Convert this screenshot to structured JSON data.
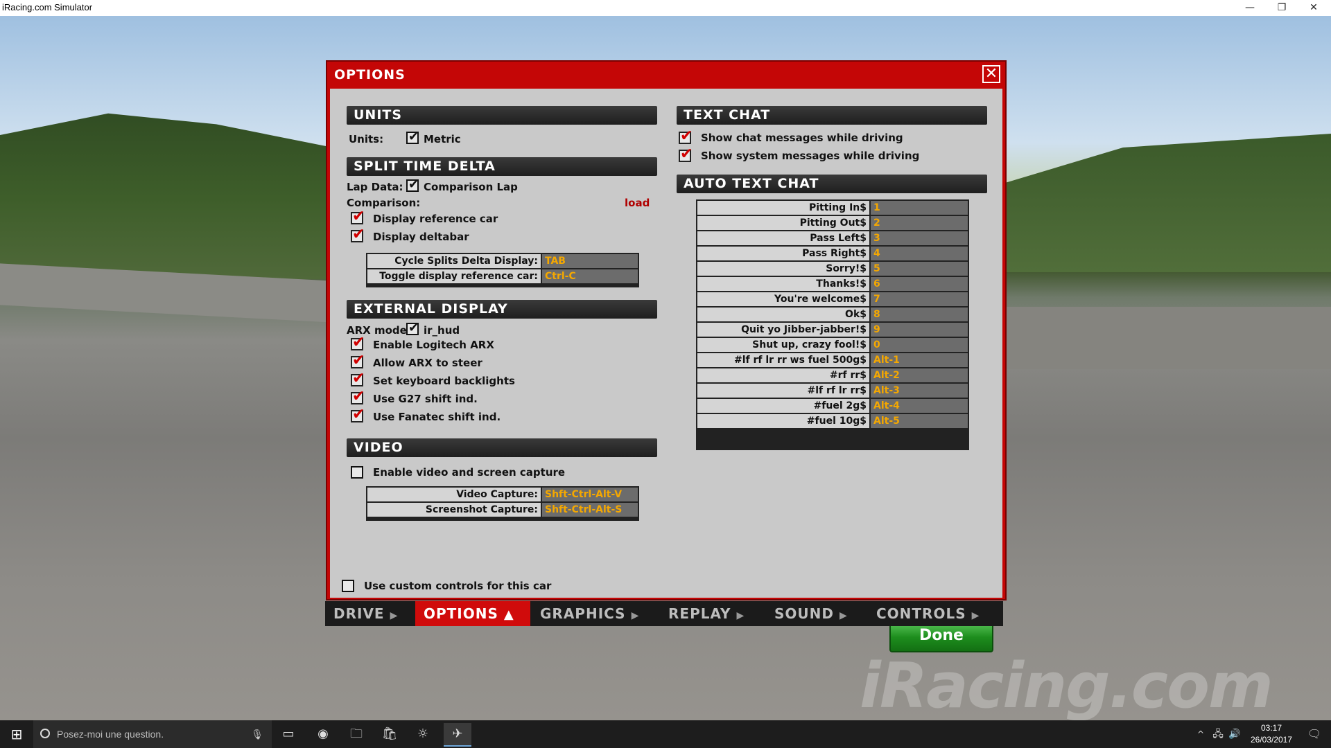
{
  "window": {
    "title": "iRacing.com Simulator",
    "minimize": "—",
    "restore": "❐",
    "close": "✕"
  },
  "watermark": "iRacing.com",
  "dialog": {
    "title": "OPTIONS",
    "close_glyph": "✕",
    "units": {
      "header": "UNITS",
      "label": "Units:",
      "metric_label": "Metric",
      "metric_checked": true
    },
    "split": {
      "header": "SPLIT TIME DELTA",
      "lap_data_label": "Lap Data:",
      "comparison_lap_label": "Comparison Lap",
      "comparison_label": "Comparison:",
      "load_label": "load",
      "display_ref_car": "Display reference car",
      "display_deltabar": "Display deltabar",
      "keys": [
        {
          "name": "Cycle Splits Delta Display:",
          "key": "TAB"
        },
        {
          "name": "Toggle display reference car:",
          "key": "Ctrl-C"
        }
      ]
    },
    "external": {
      "header": "EXTERNAL DISPLAY",
      "arx_mode_label": "ARX mode:",
      "arx_mode_value": "ir_hud",
      "options": [
        "Enable Logitech ARX",
        "Allow ARX to steer",
        "Set keyboard backlights",
        "Use G27 shift ind.",
        "Use Fanatec shift ind."
      ]
    },
    "video": {
      "header": "VIDEO",
      "enable_label": "Enable video and screen capture",
      "keys": [
        {
          "name": "Video Capture:",
          "key": "Shft-Ctrl-Alt-V"
        },
        {
          "name": "Screenshot Capture:",
          "key": "Shft-Ctrl-Alt-S"
        }
      ]
    },
    "custom_controls_label": "Use custom controls for this car",
    "text_chat": {
      "header": "TEXT CHAT",
      "show_chat": "Show chat messages while driving",
      "show_system": "Show system messages while driving"
    },
    "auto_chat": {
      "header": "AUTO TEXT CHAT",
      "rows": [
        {
          "msg": "Pitting In$",
          "key": "1"
        },
        {
          "msg": "Pitting Out$",
          "key": "2"
        },
        {
          "msg": "Pass Left$",
          "key": "3"
        },
        {
          "msg": "Pass Right$",
          "key": "4"
        },
        {
          "msg": "Sorry!$",
          "key": "5"
        },
        {
          "msg": "Thanks!$",
          "key": "6"
        },
        {
          "msg": "You're welcome$",
          "key": "7"
        },
        {
          "msg": "Ok$",
          "key": "8"
        },
        {
          "msg": "Quit yo Jibber-jabber!$",
          "key": "9"
        },
        {
          "msg": "Shut up, crazy fool!$",
          "key": "0"
        },
        {
          "msg": "#lf rf lr rr ws fuel 500g$",
          "key": "Alt-1"
        },
        {
          "msg": "#rf rr$",
          "key": "Alt-2"
        },
        {
          "msg": "#lf rf lr rr$",
          "key": "Alt-3"
        },
        {
          "msg": "#fuel 2g$",
          "key": "Alt-4"
        },
        {
          "msg": "#fuel 10g$",
          "key": "Alt-5"
        }
      ]
    },
    "done_label": "Done"
  },
  "tabs": [
    {
      "label": "DRIVE",
      "active": false
    },
    {
      "label": "OPTIONS",
      "active": true
    },
    {
      "label": "GRAPHICS",
      "active": false
    },
    {
      "label": "REPLAY",
      "active": false
    },
    {
      "label": "SOUND",
      "active": false
    },
    {
      "label": "CONTROLS",
      "active": false
    }
  ],
  "taskbar": {
    "search_placeholder": "Posez-moi une question.",
    "time": "03:17",
    "date": "26/03/2017"
  }
}
